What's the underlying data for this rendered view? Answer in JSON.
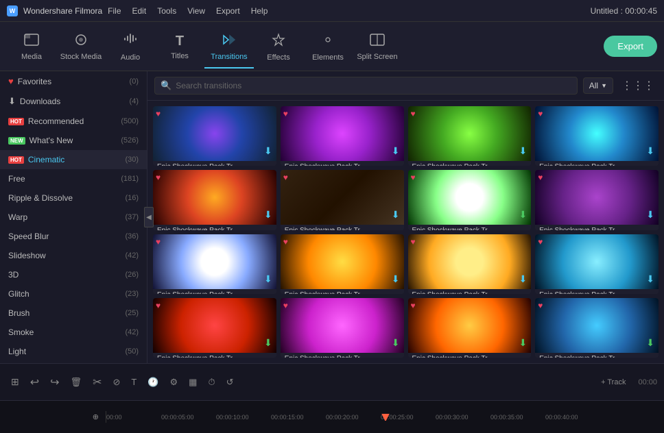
{
  "titlebar": {
    "logo": "W",
    "appname": "Wondershare Filmora",
    "menu": [
      "File",
      "Edit",
      "Tools",
      "View",
      "Export",
      "Help"
    ],
    "project": "Untitled : 00:00:45"
  },
  "toolbar": {
    "items": [
      {
        "id": "media",
        "label": "Media",
        "icon": "🎬"
      },
      {
        "id": "stock-media",
        "label": "Stock Media",
        "icon": "📷"
      },
      {
        "id": "audio",
        "label": "Audio",
        "icon": "🎵"
      },
      {
        "id": "titles",
        "label": "Titles",
        "icon": "T"
      },
      {
        "id": "transitions",
        "label": "Transitions",
        "icon": "✦"
      },
      {
        "id": "effects",
        "label": "Effects",
        "icon": "✨"
      },
      {
        "id": "elements",
        "label": "Elements",
        "icon": "⬡"
      },
      {
        "id": "split-screen",
        "label": "Split Screen",
        "icon": "⊞"
      }
    ],
    "active": "transitions",
    "export_label": "Export"
  },
  "sidebar": {
    "items": [
      {
        "id": "favorites",
        "label": "Favorites",
        "count": "(0)",
        "icon": "heart",
        "badge": ""
      },
      {
        "id": "downloads",
        "label": "Downloads",
        "count": "(4)",
        "icon": "download",
        "badge": ""
      },
      {
        "id": "recommended",
        "label": "Recommended",
        "count": "(500)",
        "icon": "hot",
        "badge": "HOT"
      },
      {
        "id": "whats-new",
        "label": "What's New",
        "count": "(526)",
        "icon": "new",
        "badge": "NEW"
      },
      {
        "id": "cinematic",
        "label": "Cinematic",
        "count": "(30)",
        "icon": "hot",
        "badge": "HOT",
        "active": true
      },
      {
        "id": "free",
        "label": "Free",
        "count": "(181)",
        "icon": "",
        "badge": ""
      },
      {
        "id": "ripple-dissolve",
        "label": "Ripple & Dissolve",
        "count": "(16)",
        "icon": "",
        "badge": ""
      },
      {
        "id": "warp",
        "label": "Warp",
        "count": "(37)",
        "icon": "",
        "badge": ""
      },
      {
        "id": "speed-blur",
        "label": "Speed Blur",
        "count": "(36)",
        "icon": "",
        "badge": ""
      },
      {
        "id": "slideshow",
        "label": "Slideshow",
        "count": "(42)",
        "icon": "",
        "badge": ""
      },
      {
        "id": "3d",
        "label": "3D",
        "count": "(26)",
        "icon": "",
        "badge": ""
      },
      {
        "id": "glitch",
        "label": "Glitch",
        "count": "(23)",
        "icon": "",
        "badge": ""
      },
      {
        "id": "brush",
        "label": "Brush",
        "count": "(25)",
        "icon": "",
        "badge": ""
      },
      {
        "id": "smoke",
        "label": "Smoke",
        "count": "(42)",
        "icon": "",
        "badge": ""
      },
      {
        "id": "light",
        "label": "Light",
        "count": "(50)",
        "icon": "",
        "badge": ""
      }
    ]
  },
  "search": {
    "placeholder": "Search transitions",
    "filter_label": "All",
    "grid_icon": "⋮⋮⋮"
  },
  "transitions": {
    "cards": [
      {
        "id": 1,
        "label": "Epic Shockwave Pack Tr...",
        "bg": "purple-blue",
        "heart": true,
        "download_color": "cyan"
      },
      {
        "id": 2,
        "label": "Epic Shockwave Pack Tr...",
        "bg": "purple-pink",
        "heart": true,
        "download_color": "cyan"
      },
      {
        "id": 3,
        "label": "Epic Shockwave Pack Tr...",
        "bg": "green-yellow",
        "heart": true,
        "download_color": "cyan"
      },
      {
        "id": 4,
        "label": "Epic Shockwave Pack Tr...",
        "bg": "cyan-blue",
        "heart": true,
        "download_color": "cyan"
      },
      {
        "id": 5,
        "label": "Epic Shockwave Pack Tr...",
        "bg": "orange-red",
        "heart": true,
        "download_color": "cyan"
      },
      {
        "id": 6,
        "label": "Epic Shockwave Pack Tr...",
        "bg": "dark-person",
        "heart": true,
        "download_color": "cyan"
      },
      {
        "id": 7,
        "label": "Epic Shockwave Pack Tr...",
        "bg": "green-white",
        "heart": true,
        "download_color": "green"
      },
      {
        "id": 8,
        "label": "Epic Shockwave Pack Tr...",
        "bg": "purple-dark",
        "heart": true,
        "download_color": "cyan"
      },
      {
        "id": 9,
        "label": "Epic Shockwave Pack Tr...",
        "bg": "white-blue",
        "heart": true,
        "download_color": "cyan"
      },
      {
        "id": 10,
        "label": "Epic Shockwave Pack Tr...",
        "bg": "gold-yellow",
        "heart": true,
        "download_color": "cyan"
      },
      {
        "id": 11,
        "label": "Epic Shockwave Pack Tr...",
        "bg": "gold-sun",
        "heart": true,
        "download_color": "cyan"
      },
      {
        "id": 12,
        "label": "Epic Shockwave Pack Tr...",
        "bg": "cyan-cloud",
        "heart": true,
        "download_color": "cyan"
      },
      {
        "id": 13,
        "label": "Epic Shockwave Pack Tr...",
        "bg": "red-fire",
        "heart": true,
        "download_color": "green"
      },
      {
        "id": 14,
        "label": "Epic Shockwave Pack Tr...",
        "bg": "pink-purple",
        "heart": true,
        "download_color": "green"
      },
      {
        "id": 15,
        "label": "Epic Shockwave Pack Tr...",
        "bg": "orange-sun",
        "heart": true,
        "download_color": "green"
      },
      {
        "id": 16,
        "label": "Epic Shockwave Pack Tr...",
        "bg": "blue-teal",
        "heart": true,
        "download_color": "green"
      }
    ]
  },
  "timeline_controls": {
    "buttons": [
      "⊞",
      "↩",
      "↪",
      "🗑",
      "✂",
      "⊘",
      "T",
      "🕐",
      "⚙",
      "▦",
      "⏱",
      "↺"
    ],
    "zoom_label": "00:00"
  },
  "timeline_ruler": {
    "times": [
      "00:00",
      "00:00:05:00",
      "00:00:10:00",
      "00:00:15:00",
      "00:00:20:00",
      "00:00:25:00",
      "00:00:30:00",
      "00:00:35:00",
      "00:00:40:00"
    ]
  }
}
